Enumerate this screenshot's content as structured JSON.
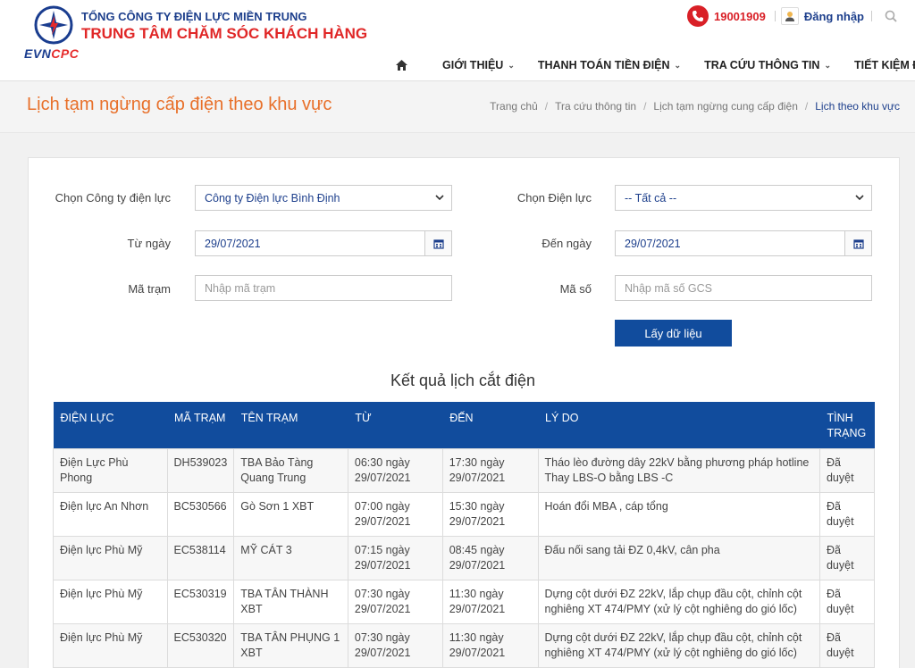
{
  "header": {
    "company_line1": "TỔNG CÔNG TY ĐIỆN LỰC MIỀN TRUNG",
    "company_line2": "TRUNG TÂM CHĂM SÓC KHÁCH HÀNG",
    "logo_evn": "EVN",
    "logo_cpc": "CPC",
    "hotline": "19001909",
    "login_label": "Đăng nhập",
    "icons": [
      "phone-icon",
      "user-icon",
      "search-icon",
      "home-icon"
    ]
  },
  "nav": {
    "items": [
      {
        "label": "GIỚI THIỆU",
        "chev": "⌄"
      },
      {
        "label": "THANH TOÁN TIỀN ĐIỆN",
        "chev": "⌄"
      },
      {
        "label": "TRA CỨU THÔNG TIN",
        "chev": "⌄"
      },
      {
        "label": "TIẾT KIỆM ĐIỆN",
        "chev": ""
      }
    ]
  },
  "page": {
    "title": "Lịch tạm ngừng cấp điện theo khu vực",
    "breadcrumb": [
      "Trang chủ",
      "Tra cứu thông tin",
      "Lịch tạm ngừng cung cấp điện",
      "Lịch theo khu vực"
    ]
  },
  "form": {
    "company_label": "Chọn Công ty điện lực",
    "company_value": "Công ty Điện lực Bình Định",
    "branch_label": "Chọn Điện lực",
    "branch_value": "-- Tất cả --",
    "from_label": "Từ ngày",
    "from_value": "29/07/2021",
    "to_label": "Đến ngày",
    "to_value": "29/07/2021",
    "station_label": "Mã trạm",
    "station_placeholder": "Nhập mã trạm",
    "code_label": "Mã số",
    "code_placeholder": "Nhập mã số GCS",
    "fetch_button": "Lấy dữ liệu"
  },
  "results": {
    "title": "Kết quả lịch cắt điện",
    "columns": [
      "ĐIỆN LỰC",
      "MÃ TRẠM",
      "TÊN TRẠM",
      "TỪ",
      "ĐẾN",
      "LÝ DO",
      "TÌNH TRẠNG"
    ],
    "rows": [
      [
        "Điện Lực Phù Phong",
        "DH539023",
        "TBA Bảo Tàng Quang Trung",
        "06:30 ngày 29/07/2021",
        "17:30 ngày 29/07/2021",
        "Tháo lèo đường dây 22kV bằng phương pháp hotline Thay LBS-O bằng LBS -C",
        "Đã duyệt"
      ],
      [
        "Điện lực An Nhơn",
        "BC530566",
        "Gò Sơn 1 XBT",
        "07:00 ngày 29/07/2021",
        "15:30 ngày 29/07/2021",
        "Hoán đổi MBA , cáp tổng",
        "Đã duyệt"
      ],
      [
        "Điện lực Phù Mỹ",
        "EC538114",
        "MỸ CÁT 3",
        "07:15 ngày 29/07/2021",
        "08:45 ngày 29/07/2021",
        "Đấu nối sang tải ĐZ 0,4kV, cân pha",
        "Đã duyệt"
      ],
      [
        "Điện lực Phù Mỹ",
        "EC530319",
        "TBA TÂN THÀNH XBT",
        "07:30 ngày 29/07/2021",
        "11:30 ngày 29/07/2021",
        "Dựng cột dưới ĐZ 22kV, lắp chụp đầu cột, chỉnh cột nghiêng XT 474/PMY (xử lý cột nghiêng do gió lốc)",
        "Đã duyệt"
      ],
      [
        "Điện lực Phù Mỹ",
        "EC530320",
        "TBA TÂN PHỤNG 1 XBT",
        "07:30 ngày 29/07/2021",
        "11:30 ngày 29/07/2021",
        "Dựng cột dưới ĐZ 22kV, lắp chụp đầu cột, chỉnh cột nghiêng XT 474/PMY (xử lý cột nghiêng do gió lốc)",
        "Đã duyệt"
      ]
    ]
  },
  "colors": {
    "brand_blue": "#114c9d",
    "brand_red": "#e02727",
    "title_orange": "#e8702a"
  }
}
